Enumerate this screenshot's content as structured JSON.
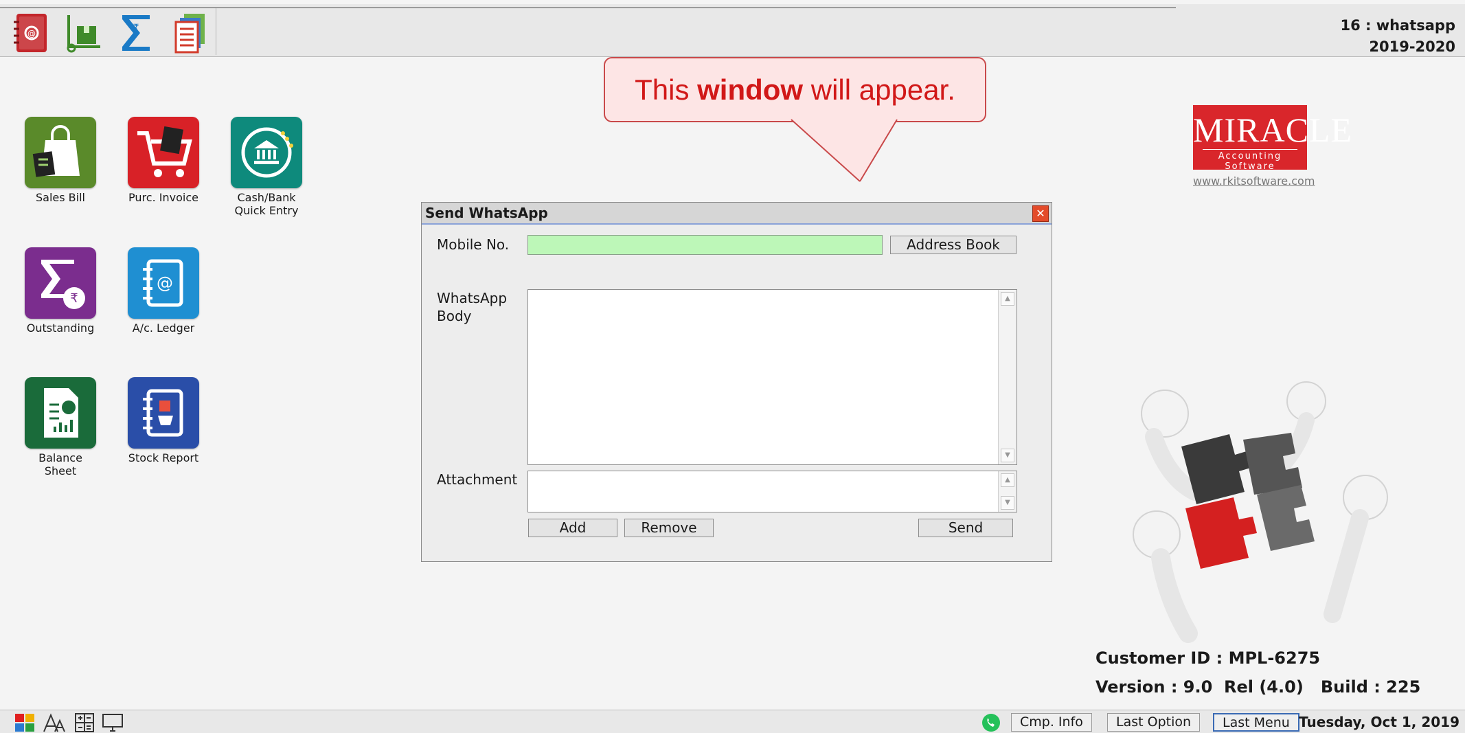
{
  "company": {
    "line1": "16 : whatsapp",
    "line2": "2019-2020"
  },
  "toolbar_icons": [
    "address-book-icon",
    "delivery-icon",
    "sigma-icon",
    "report-stack-icon"
  ],
  "desktop": [
    {
      "label": "Sales Bill",
      "icon": "sales-bill-icon",
      "color": "#5a8a2a"
    },
    {
      "label": "Purc. Invoice",
      "icon": "purchase-cart-icon",
      "color": "#d82127"
    },
    {
      "label": "Cash/Bank\nQuick Entry",
      "icon": "bank-icon",
      "color": "#0e8a7c"
    },
    {
      "label": "Outstanding",
      "icon": "outstanding-icon",
      "color": "#7b2d8e"
    },
    {
      "label": "A/c. Ledger",
      "icon": "ledger-icon",
      "color": "#1f8fd2"
    },
    {
      "label": "Balance\nSheet",
      "icon": "balance-sheet-icon",
      "color": "#1a6b3a"
    },
    {
      "label": "Stock Report",
      "icon": "stock-report-icon",
      "color": "#2a4ea8"
    }
  ],
  "callout": {
    "pre": "This ",
    "bold": "window",
    "post": " will appear."
  },
  "logo": {
    "brand": "MIRACLE",
    "tagline": "Accounting Software",
    "url": "www.rkitsoftware.com"
  },
  "dialog": {
    "title": "Send WhatsApp",
    "mobile_label": "Mobile No.",
    "mobile_value": "",
    "address_book": "Address Book",
    "body_label": "WhatsApp\nBody",
    "attachment_label": "Attachment",
    "add": "Add",
    "remove": "Remove",
    "send": "Send"
  },
  "customer": {
    "id_line": "Customer ID : MPL-6275",
    "version_line": "Version : 9.0  Rel (4.0)   Build : 225"
  },
  "statusbar": {
    "cmp_info": "Cmp. Info",
    "last_option": "Last Option",
    "last_menu": "Last Menu",
    "date": "Tuesday, Oct 1, 2019"
  },
  "colors": {
    "accent_green": "#bdf7b8",
    "callout_red": "#d11818",
    "brand_red": "#d9262b"
  }
}
